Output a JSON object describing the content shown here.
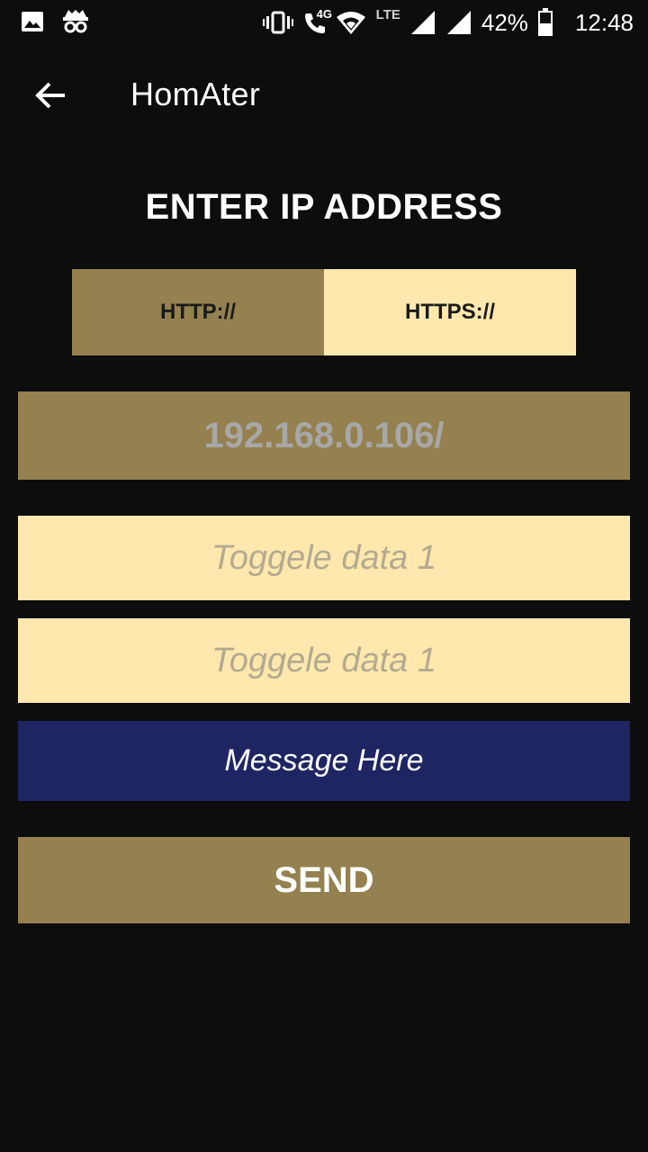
{
  "status_bar": {
    "icons": [
      "image-icon",
      "incognito-icon",
      "vibrate-icon",
      "volte-call-icon",
      "wifi-icon",
      "signal-icon",
      "signal-icon",
      "battery-icon"
    ],
    "network_label": "4G",
    "lte_label": "LTE",
    "battery": "42%",
    "time": "12:48"
  },
  "app_bar": {
    "back_icon": "arrow-back-icon",
    "title": "HomAter"
  },
  "heading": "ENTER IP ADDRESS",
  "protocol": {
    "http_label": "HTTP://",
    "https_label": "HTTPS://",
    "selected": "HTTP://"
  },
  "ip_input": {
    "value": "192.168.0.106/"
  },
  "toggle_input_1": {
    "placeholder": "Toggele data 1"
  },
  "toggle_input_2": {
    "placeholder": "Toggele data 1"
  },
  "message_input": {
    "placeholder": "Message Here"
  },
  "send_button": {
    "label": "SEND"
  },
  "colors": {
    "background": "#0d0d0d",
    "gold": "#94814f",
    "cream": "#fee8ad",
    "navy": "#1f2563"
  }
}
